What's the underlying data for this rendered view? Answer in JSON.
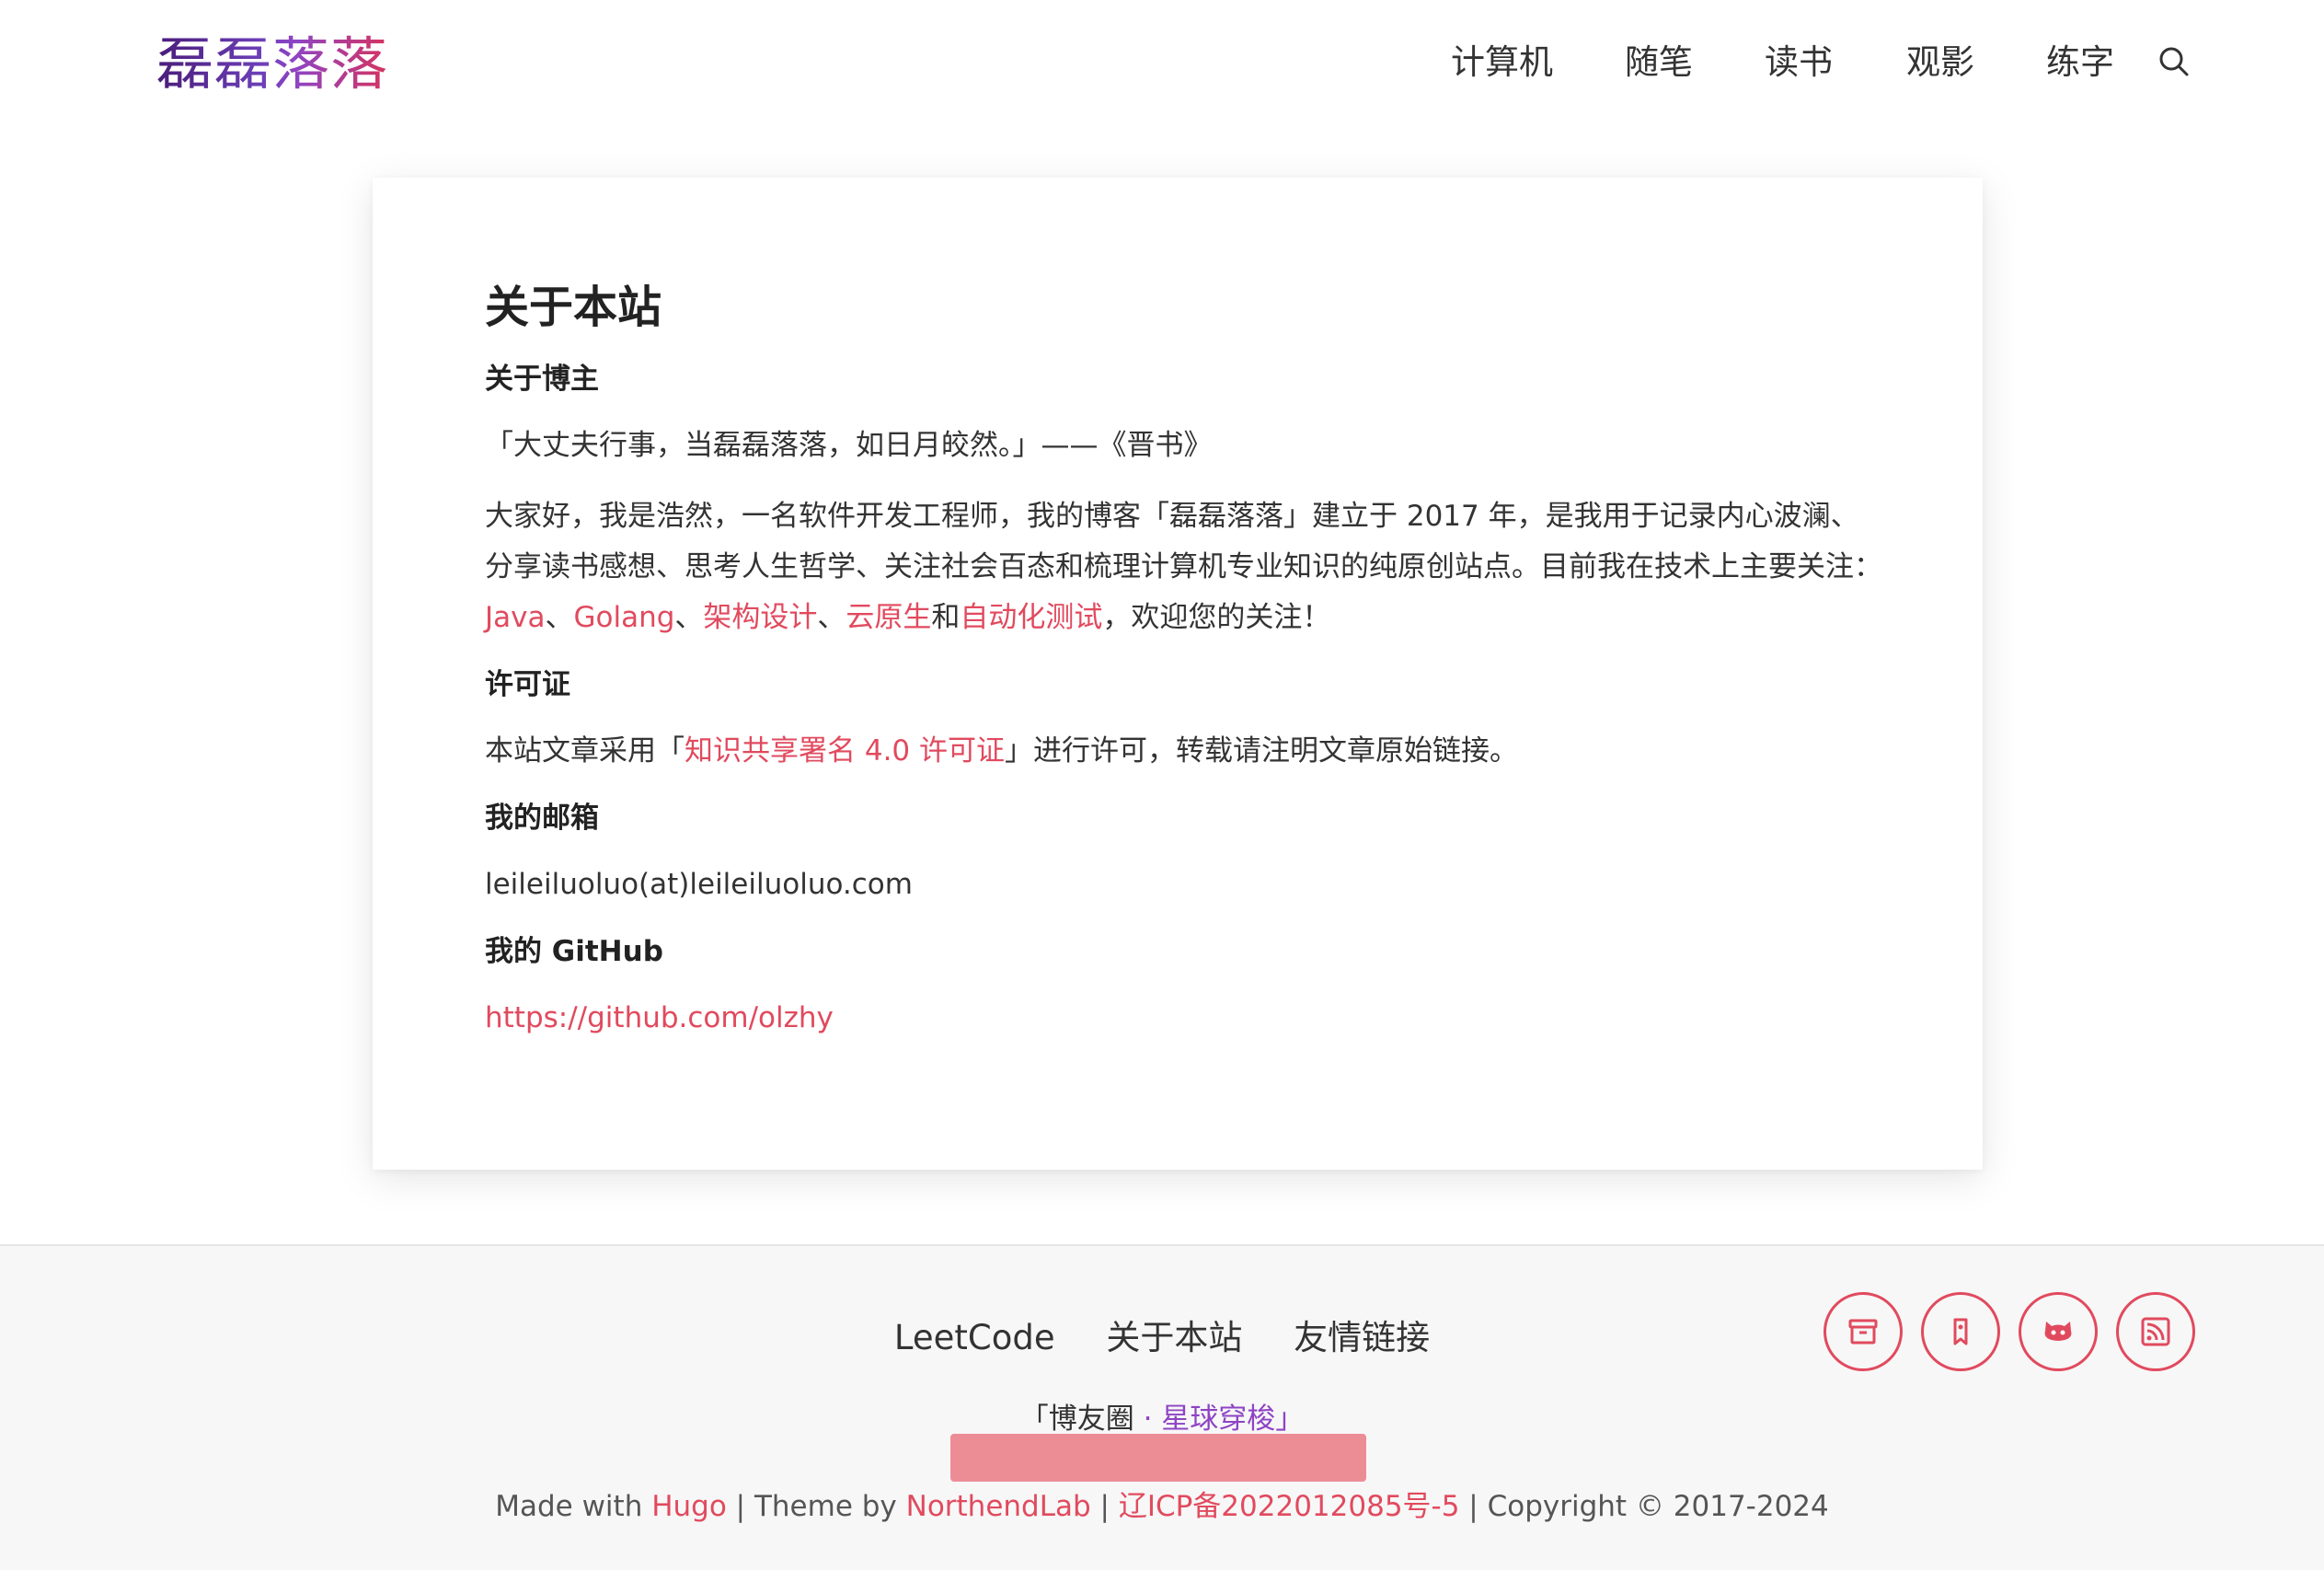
{
  "header": {
    "logo": "磊磊落落",
    "nav": [
      "计算机",
      "随笔",
      "读书",
      "观影",
      "练字"
    ],
    "search_icon": "search-icon"
  },
  "page": {
    "title": "关于本站",
    "sections": {
      "about_owner": {
        "heading": "关于博主",
        "quote": "「大丈夫行事，当磊磊落落，如日月皎然。」——《晋书》",
        "intro_prefix": "大家好，我是浩然，一名软件开发工程师，我的博客「磊磊落落」建立于 2017 年，是我用于记录内心波澜、分享读书感想、思考人生哲学、关注社会百态和梳理计算机专业知识的纯原创站点。目前我在技术上主要关注：",
        "topics": [
          "Java",
          "Golang",
          "架构设计",
          "云原生",
          "自动化测试"
        ],
        "sep1": "、",
        "conj": "和",
        "intro_suffix": "，欢迎您的关注！"
      },
      "license": {
        "heading": "许可证",
        "prefix": "本站文章采用「",
        "link": "知识共享署名 4.0 许可证",
        "suffix": "」进行许可，转载请注明文章原始链接。"
      },
      "email": {
        "heading": "我的邮箱",
        "value": "leileiluoluo(at)leileiluoluo.com"
      },
      "github": {
        "heading": "我的 GitHub",
        "url": "https://github.com/olzhy"
      }
    }
  },
  "footer": {
    "links": [
      "LeetCode",
      "关于本站",
      "友情链接"
    ],
    "social_icons": [
      "archive-icon",
      "bookmark-icon",
      "github-icon",
      "rss-icon"
    ],
    "friend_ring": {
      "open": "「",
      "label": "博友圈",
      "sep": " · ",
      "label2": "星球穿梭",
      "close": "」"
    },
    "copyright": {
      "made_with": "Made with ",
      "hugo": "Hugo",
      "theme_by": " | Theme by ",
      "theme": "NorthendLab",
      "sep": " | ",
      "icp": "辽ICP备2022012085号-5",
      "copy": " | Copyright © 2017-2024"
    }
  },
  "colors": {
    "accent": "#e14a5e",
    "purple": "#8e44c4",
    "logo_start": "#4a1c7a",
    "logo_end": "#d6335f"
  }
}
